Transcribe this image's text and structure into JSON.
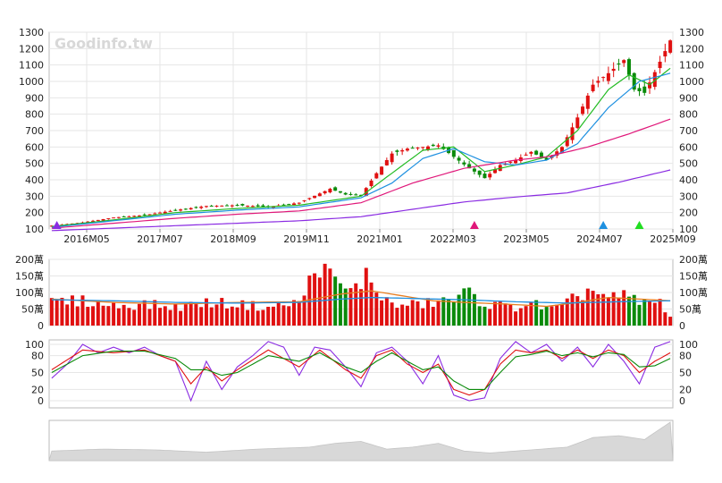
{
  "watermark": "Goodinfo.tw",
  "chart_data": [
    {
      "type": "candlestick",
      "ylim": [
        100,
        1300
      ],
      "y_ticks": [
        100,
        200,
        300,
        400,
        500,
        600,
        700,
        800,
        900,
        1000,
        1100,
        1200,
        1300
      ],
      "x_tick_labels": [
        "2016M05",
        "2017M07",
        "2018M09",
        "2019M11",
        "2021M01",
        "2022M03",
        "2023M05",
        "2024M07",
        "2025M09"
      ],
      "grid": true,
      "up_color": "#e01010",
      "down_color": "#0a8a0a",
      "close_keypoints": [
        [
          0,
          120
        ],
        [
          6,
          140
        ],
        [
          12,
          170
        ],
        [
          18,
          185
        ],
        [
          24,
          215
        ],
        [
          30,
          240
        ],
        [
          36,
          245
        ],
        [
          42,
          235
        ],
        [
          48,
          260
        ],
        [
          54,
          345
        ],
        [
          57,
          310
        ],
        [
          60,
          305
        ],
        [
          63,
          440
        ],
        [
          66,
          560
        ],
        [
          69,
          590
        ],
        [
          72,
          600
        ],
        [
          75,
          610
        ],
        [
          78,
          540
        ],
        [
          81,
          470
        ],
        [
          84,
          410
        ],
        [
          87,
          490
        ],
        [
          90,
          520
        ],
        [
          93,
          570
        ],
        [
          96,
          520
        ],
        [
          99,
          600
        ],
        [
          102,
          780
        ],
        [
          105,
          980
        ],
        [
          108,
          1050
        ],
        [
          111,
          1130
        ],
        [
          113,
          950
        ],
        [
          115,
          930
        ],
        [
          118,
          1120
        ],
        [
          120,
          1250
        ]
      ],
      "ma_lines": [
        {
          "color": "#22bb22",
          "values": [
            [
              0,
              115
            ],
            [
              12,
              155
            ],
            [
              24,
              200
            ],
            [
              36,
              225
            ],
            [
              48,
              245
            ],
            [
              60,
              300
            ],
            [
              66,
              440
            ],
            [
              72,
              580
            ],
            [
              78,
              600
            ],
            [
              84,
              450
            ],
            [
              90,
              490
            ],
            [
              96,
              540
            ],
            [
              102,
              700
            ],
            [
              108,
              950
            ],
            [
              112,
              1040
            ],
            [
              116,
              980
            ],
            [
              120,
              1080
            ]
          ]
        },
        {
          "color": "#1e90e0",
          "values": [
            [
              0,
              110
            ],
            [
              12,
              150
            ],
            [
              24,
              190
            ],
            [
              36,
              215
            ],
            [
              48,
              235
            ],
            [
              60,
              290
            ],
            [
              66,
              380
            ],
            [
              72,
              530
            ],
            [
              78,
              590
            ],
            [
              84,
              510
            ],
            [
              90,
              490
            ],
            [
              96,
              520
            ],
            [
              102,
              620
            ],
            [
              108,
              840
            ],
            [
              114,
              1000
            ],
            [
              120,
              1050
            ]
          ]
        },
        {
          "color": "#e0187a",
          "values": [
            [
              0,
              105
            ],
            [
              12,
              135
            ],
            [
              24,
              165
            ],
            [
              36,
              190
            ],
            [
              48,
              210
            ],
            [
              60,
              260
            ],
            [
              70,
              380
            ],
            [
              80,
              470
            ],
            [
              90,
              520
            ],
            [
              96,
              540
            ],
            [
              104,
              600
            ],
            [
              112,
              680
            ],
            [
              120,
              770
            ]
          ]
        },
        {
          "color": "#8a2be2",
          "values": [
            [
              0,
              90
            ],
            [
              12,
              105
            ],
            [
              24,
              120
            ],
            [
              36,
              135
            ],
            [
              48,
              150
            ],
            [
              60,
              175
            ],
            [
              70,
              220
            ],
            [
              80,
              265
            ],
            [
              90,
              295
            ],
            [
              100,
              320
            ],
            [
              110,
              385
            ],
            [
              120,
              460
            ]
          ]
        }
      ],
      "markers": [
        {
          "index": 1,
          "color": "#8a2be2"
        },
        {
          "index": 82,
          "color": "#e0187a"
        },
        {
          "index": 107,
          "color": "#1e90e0"
        },
        {
          "index": 114,
          "color": "#22dd22"
        }
      ]
    },
    {
      "type": "bar",
      "ylim": [
        0,
        200
      ],
      "y_ticks": [
        "0",
        "50萬",
        "100萬",
        "150萬",
        "200萬"
      ],
      "volume_keypoints": [
        [
          0,
          70
        ],
        [
          6,
          75
        ],
        [
          12,
          60
        ],
        [
          18,
          65
        ],
        [
          24,
          55
        ],
        [
          30,
          70
        ],
        [
          36,
          65
        ],
        [
          42,
          55
        ],
        [
          48,
          70
        ],
        [
          52,
          190
        ],
        [
          54,
          145
        ],
        [
          58,
          100
        ],
        [
          61,
          150
        ],
        [
          63,
          110
        ],
        [
          66,
          60
        ],
        [
          72,
          65
        ],
        [
          78,
          80
        ],
        [
          81,
          100
        ],
        [
          84,
          65
        ],
        [
          87,
          60
        ],
        [
          90,
          55
        ],
        [
          93,
          70
        ],
        [
          96,
          50
        ],
        [
          99,
          55
        ],
        [
          102,
          90
        ],
        [
          105,
          110
        ],
        [
          108,
          80
        ],
        [
          111,
          90
        ],
        [
          114,
          70
        ],
        [
          118,
          70
        ],
        [
          120,
          30
        ]
      ],
      "ma_lines": [
        {
          "color": "#e67e22",
          "values": [
            [
              0,
              80
            ],
            [
              12,
              70
            ],
            [
              24,
              65
            ],
            [
              36,
              70
            ],
            [
              48,
              72
            ],
            [
              56,
              95
            ],
            [
              62,
              105
            ],
            [
              68,
              90
            ],
            [
              74,
              75
            ],
            [
              80,
              70
            ],
            [
              88,
              65
            ],
            [
              96,
              58
            ],
            [
              102,
              70
            ],
            [
              108,
              85
            ],
            [
              114,
              80
            ],
            [
              120,
              75
            ]
          ]
        },
        {
          "color": "#1e90e0",
          "values": [
            [
              0,
              78
            ],
            [
              12,
              75
            ],
            [
              24,
              70
            ],
            [
              36,
              68
            ],
            [
              48,
              70
            ],
            [
              56,
              80
            ],
            [
              62,
              85
            ],
            [
              70,
              82
            ],
            [
              80,
              78
            ],
            [
              90,
              72
            ],
            [
              100,
              68
            ],
            [
              110,
              72
            ],
            [
              120,
              75
            ]
          ]
        }
      ]
    },
    {
      "type": "line",
      "ylim": [
        0,
        100
      ],
      "y_ticks": [
        0,
        20,
        50,
        80,
        100
      ],
      "series": [
        {
          "color": "#8a2be2",
          "values": [
            [
              0,
              40
            ],
            [
              3,
              65
            ],
            [
              6,
              100
            ],
            [
              9,
              85
            ],
            [
              12,
              95
            ],
            [
              15,
              85
            ],
            [
              18,
              95
            ],
            [
              21,
              80
            ],
            [
              24,
              70
            ],
            [
              27,
              0
            ],
            [
              30,
              70
            ],
            [
              33,
              20
            ],
            [
              36,
              60
            ],
            [
              39,
              80
            ],
            [
              42,
              105
            ],
            [
              45,
              95
            ],
            [
              48,
              45
            ],
            [
              51,
              95
            ],
            [
              54,
              90
            ],
            [
              57,
              60
            ],
            [
              60,
              25
            ],
            [
              63,
              85
            ],
            [
              66,
              95
            ],
            [
              69,
              70
            ],
            [
              72,
              30
            ],
            [
              75,
              80
            ],
            [
              78,
              10
            ],
            [
              81,
              0
            ],
            [
              84,
              5
            ],
            [
              87,
              75
            ],
            [
              90,
              105
            ],
            [
              93,
              85
            ],
            [
              96,
              100
            ],
            [
              99,
              70
            ],
            [
              102,
              95
            ],
            [
              105,
              60
            ],
            [
              108,
              100
            ],
            [
              111,
              70
            ],
            [
              114,
              30
            ],
            [
              117,
              95
            ],
            [
              120,
              105
            ]
          ]
        },
        {
          "color": "#e01010",
          "values": [
            [
              0,
              55
            ],
            [
              6,
              90
            ],
            [
              12,
              85
            ],
            [
              18,
              90
            ],
            [
              24,
              70
            ],
            [
              27,
              30
            ],
            [
              30,
              60
            ],
            [
              33,
              35
            ],
            [
              36,
              55
            ],
            [
              42,
              90
            ],
            [
              48,
              60
            ],
            [
              52,
              90
            ],
            [
              57,
              55
            ],
            [
              60,
              40
            ],
            [
              63,
              80
            ],
            [
              66,
              90
            ],
            [
              69,
              65
            ],
            [
              72,
              50
            ],
            [
              75,
              65
            ],
            [
              78,
              20
            ],
            [
              81,
              10
            ],
            [
              84,
              20
            ],
            [
              87,
              65
            ],
            [
              90,
              90
            ],
            [
              93,
              85
            ],
            [
              96,
              90
            ],
            [
              99,
              75
            ],
            [
              102,
              90
            ],
            [
              105,
              75
            ],
            [
              108,
              90
            ],
            [
              111,
              80
            ],
            [
              114,
              50
            ],
            [
              117,
              70
            ],
            [
              120,
              85
            ]
          ]
        },
        {
          "color": "#0a8a0a",
          "values": [
            [
              0,
              50
            ],
            [
              6,
              80
            ],
            [
              12,
              88
            ],
            [
              18,
              88
            ],
            [
              24,
              75
            ],
            [
              27,
              55
            ],
            [
              30,
              55
            ],
            [
              33,
              45
            ],
            [
              36,
              50
            ],
            [
              42,
              80
            ],
            [
              48,
              70
            ],
            [
              52,
              85
            ],
            [
              57,
              60
            ],
            [
              60,
              50
            ],
            [
              63,
              70
            ],
            [
              66,
              85
            ],
            [
              69,
              70
            ],
            [
              72,
              55
            ],
            [
              75,
              60
            ],
            [
              78,
              35
            ],
            [
              81,
              20
            ],
            [
              84,
              20
            ],
            [
              87,
              50
            ],
            [
              90,
              78
            ],
            [
              93,
              82
            ],
            [
              96,
              88
            ],
            [
              99,
              80
            ],
            [
              102,
              85
            ],
            [
              105,
              78
            ],
            [
              108,
              85
            ],
            [
              111,
              82
            ],
            [
              114,
              60
            ],
            [
              117,
              62
            ],
            [
              120,
              75
            ]
          ]
        }
      ]
    },
    {
      "type": "area",
      "color": "#d8d8d8",
      "values": [
        [
          0,
          0.25
        ],
        [
          10,
          0.3
        ],
        [
          20,
          0.28
        ],
        [
          30,
          0.22
        ],
        [
          40,
          0.3
        ],
        [
          50,
          0.35
        ],
        [
          55,
          0.45
        ],
        [
          60,
          0.5
        ],
        [
          65,
          0.3
        ],
        [
          70,
          0.35
        ],
        [
          75,
          0.45
        ],
        [
          80,
          0.25
        ],
        [
          85,
          0.2
        ],
        [
          90,
          0.25
        ],
        [
          95,
          0.3
        ],
        [
          100,
          0.35
        ],
        [
          105,
          0.6
        ],
        [
          110,
          0.65
        ],
        [
          115,
          0.55
        ],
        [
          120,
          1.0
        ]
      ]
    }
  ]
}
